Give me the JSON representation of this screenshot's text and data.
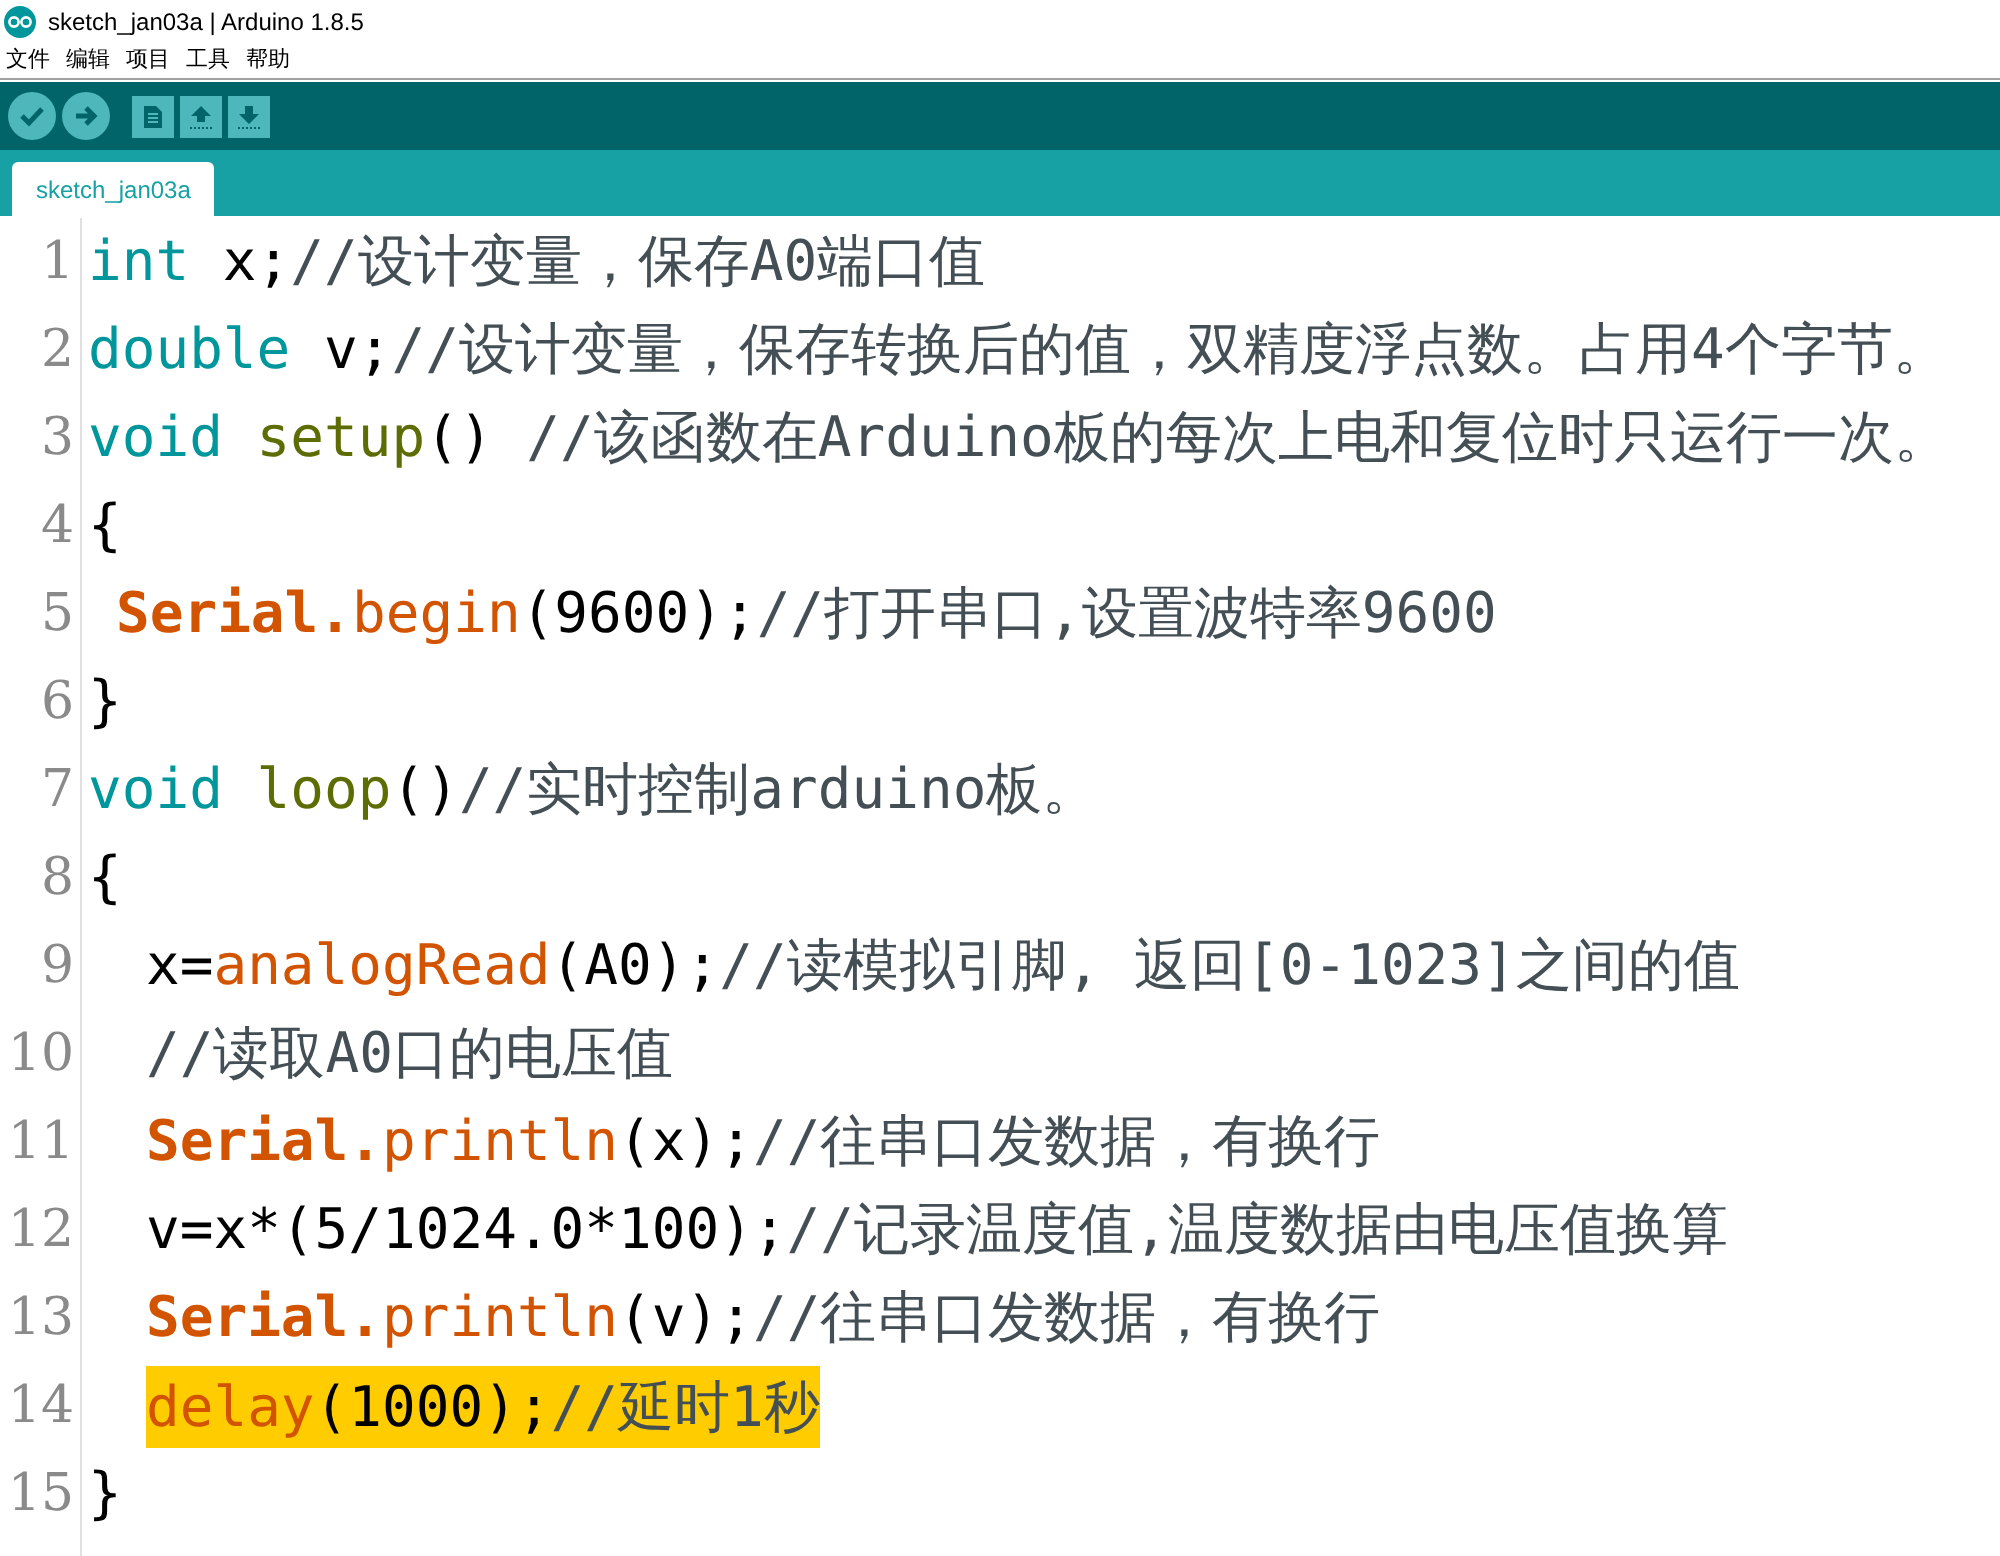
{
  "window": {
    "title": "sketch_jan03a | Arduino 1.8.5"
  },
  "menu": [
    "文件",
    "编辑",
    "项目",
    "工具",
    "帮助"
  ],
  "toolbar": [
    {
      "kind": "check"
    },
    {
      "kind": "arrow"
    },
    {
      "kind": "new"
    },
    {
      "kind": "open"
    },
    {
      "kind": "save"
    }
  ],
  "tabs": [
    {
      "label": "sketch_jan03a",
      "selected": true
    }
  ],
  "code_lines": [
    {
      "number": "1",
      "kind": "top",
      "highlighted": false,
      "tokens": [
        {
          "text": "int",
          "kind": "type"
        },
        {
          "text": " x;",
          "kind": "plain"
        },
        {
          "text": "//设计变量，保存A0端口值",
          "kind": "comment"
        }
      ]
    },
    {
      "number": "2",
      "kind": "top",
      "highlighted": false,
      "tokens": [
        {
          "text": "double",
          "kind": "type"
        },
        {
          "text": " v;",
          "kind": "plain"
        },
        {
          "text": "//设计变量，保存转换后的值，双精度浮点数。占用4个字节。",
          "kind": "comment"
        }
      ]
    },
    {
      "number": "3",
      "kind": "top",
      "highlighted": false,
      "tokens": [
        {
          "text": "void ",
          "kind": "type"
        },
        {
          "text": "setup",
          "kind": "builtin"
        },
        {
          "text": "() ",
          "kind": "plain"
        },
        {
          "text": "//该函数在Arduino板的每次上电和复位时只运行一次。",
          "kind": "comment"
        }
      ]
    },
    {
      "number": "4",
      "kind": "top",
      "highlighted": false,
      "tokens": [
        {
          "text": "{",
          "kind": "plain"
        }
      ]
    },
    {
      "number": "5",
      "kind": "shallow",
      "highlighted": false,
      "tokens": [
        {
          "text": "Serial.",
          "kind": "class"
        },
        {
          "text": "begin",
          "kind": "func"
        },
        {
          "text": "(9600);",
          "kind": "plain"
        },
        {
          "text": "//打开串口,设置波特率9600",
          "kind": "comment"
        }
      ]
    },
    {
      "number": "6",
      "kind": "top",
      "highlighted": false,
      "tokens": [
        {
          "text": "}",
          "kind": "plain"
        }
      ]
    },
    {
      "number": "7",
      "kind": "top",
      "highlighted": false,
      "tokens": [
        {
          "text": "void ",
          "kind": "type"
        },
        {
          "text": "loop",
          "kind": "builtin"
        },
        {
          "text": "()",
          "kind": "plain"
        },
        {
          "text": "//实时控制arduino板。",
          "kind": "comment"
        }
      ]
    },
    {
      "number": "8",
      "kind": "top",
      "highlighted": false,
      "tokens": [
        {
          "text": "{",
          "kind": "plain"
        }
      ]
    },
    {
      "number": "9",
      "kind": "deep",
      "highlighted": false,
      "tokens": [
        {
          "text": "x=",
          "kind": "plain"
        },
        {
          "text": "analogRead",
          "kind": "func"
        },
        {
          "text": "(A0);",
          "kind": "plain"
        },
        {
          "text": "//读模拟引脚, 返回[0-1023]之间的值",
          "kind": "comment"
        }
      ]
    },
    {
      "number": "10",
      "kind": "deep",
      "highlighted": false,
      "tokens": [
        {
          "text": "//读取A0口的电压值",
          "kind": "comment"
        }
      ]
    },
    {
      "number": "11",
      "kind": "deep",
      "highlighted": false,
      "tokens": [
        {
          "text": "Serial.",
          "kind": "class"
        },
        {
          "text": "println",
          "kind": "func"
        },
        {
          "text": "(x);",
          "kind": "plain"
        },
        {
          "text": "//往串口发数据，有换行",
          "kind": "comment"
        }
      ]
    },
    {
      "number": "12",
      "kind": "deep",
      "highlighted": false,
      "tokens": [
        {
          "text": "v=x*(5/1024.0*100);",
          "kind": "plain"
        },
        {
          "text": "//记录温度值,温度数据由电压值换算",
          "kind": "comment"
        }
      ]
    },
    {
      "number": "13",
      "kind": "deep",
      "highlighted": false,
      "tokens": [
        {
          "text": "Serial.",
          "kind": "class"
        },
        {
          "text": "println",
          "kind": "func"
        },
        {
          "text": "(v);",
          "kind": "plain"
        },
        {
          "text": "//往串口发数据，有换行",
          "kind": "comment"
        }
      ]
    },
    {
      "number": "14",
      "kind": "deep",
      "highlighted": true,
      "tokens": [
        {
          "text": "delay",
          "kind": "func"
        },
        {
          "text": "(1000);",
          "kind": "plain"
        },
        {
          "text": "//延时1秒",
          "kind": "comment"
        }
      ]
    },
    {
      "number": "15",
      "kind": "top",
      "highlighted": false,
      "tokens": [
        {
          "text": "}",
          "kind": "plain"
        }
      ]
    }
  ]
}
